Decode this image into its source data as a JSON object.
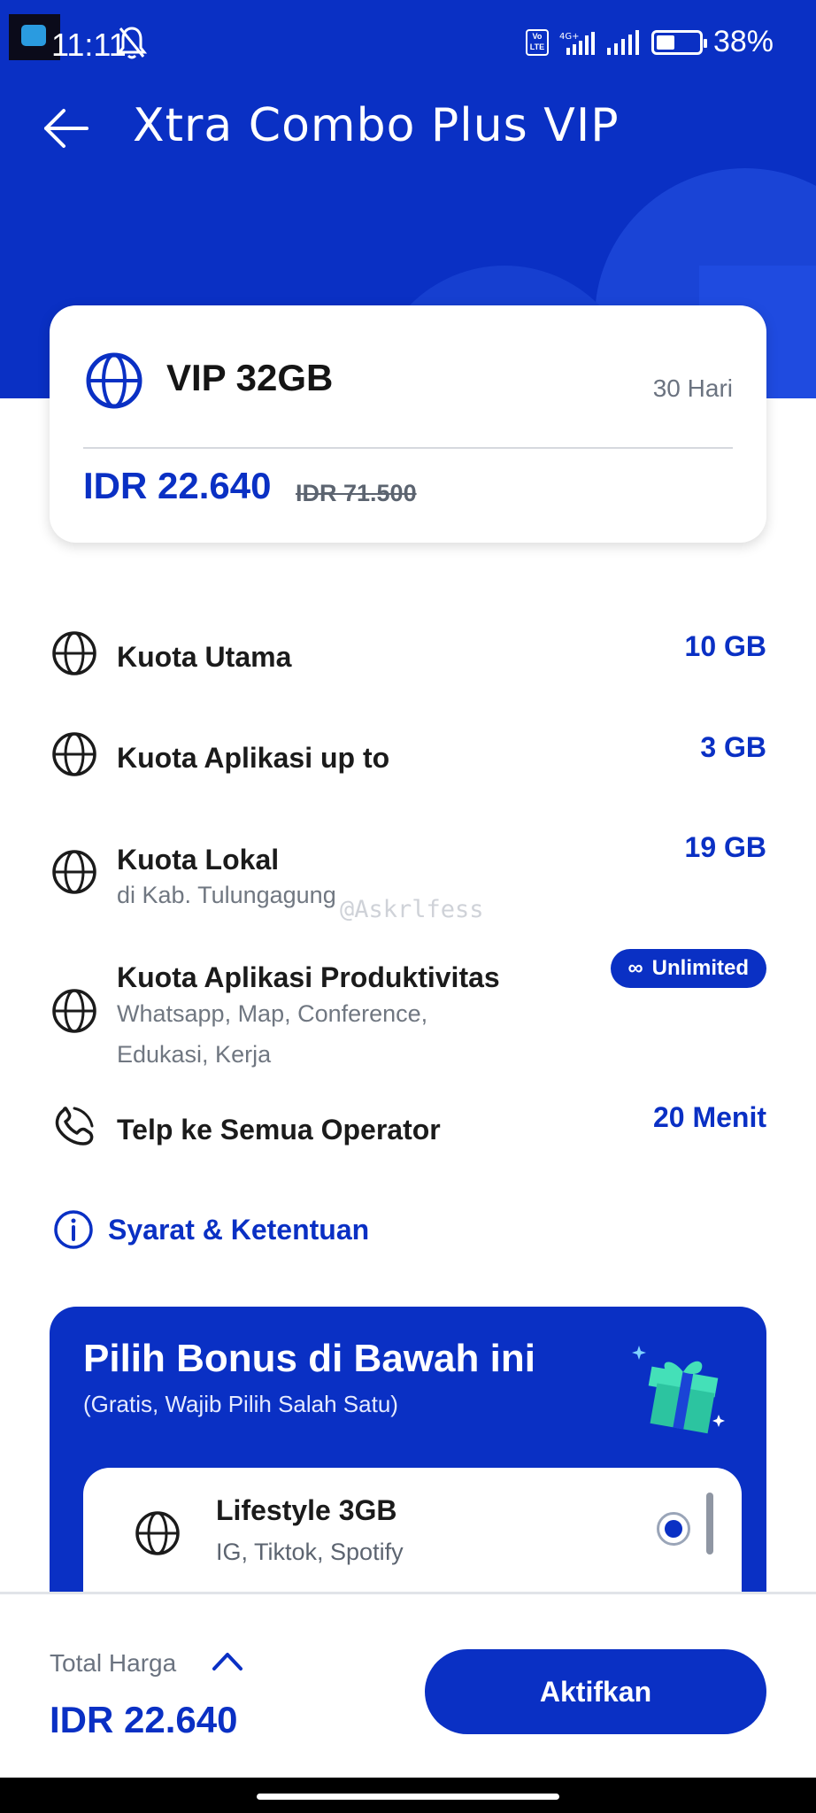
{
  "status_bar": {
    "time": "11:11",
    "network": "4G+",
    "battery": "38%"
  },
  "header": {
    "title": "Xtra Combo Plus VIP"
  },
  "package": {
    "name": "VIP 32GB",
    "duration": "30 Hari",
    "price": "IDR 22.640",
    "old_price": "IDR 71.500"
  },
  "benefits": [
    {
      "title": "Kuota Utama",
      "value": "10 GB",
      "icon": "globe-icon"
    },
    {
      "title": "Kuota Aplikasi up to",
      "value": "3 GB",
      "icon": "globe-icon"
    },
    {
      "title": "Kuota Lokal",
      "subtitle": "di Kab. Tulungagung",
      "value": "19 GB",
      "icon": "globe-icon"
    },
    {
      "title": "Kuota Aplikasi Produktivitas",
      "subtitle": "Whatsapp, Map, Conference, Edukasi, Kerja",
      "value": "Unlimited",
      "icon": "globe-icon"
    },
    {
      "title": "Telp ke Semua Operator",
      "value": "20 Menit",
      "icon": "phone-icon"
    }
  ],
  "watermark": "@Askrlfess",
  "terms": {
    "label": "Syarat & Ketentuan"
  },
  "bonus": {
    "title": "Pilih Bonus di Bawah ini",
    "subtitle": "(Gratis, Wajib Pilih Salah Satu)",
    "options": [
      {
        "name": "Lifestyle 3GB",
        "apps": "IG, Tiktok, Spotify",
        "selected": true
      }
    ]
  },
  "footer": {
    "total_label": "Total Harga",
    "total_price": "IDR 22.640",
    "activate_label": "Aktifkan"
  },
  "colors": {
    "brand": "#0a30c4",
    "muted": "#6b7380"
  }
}
